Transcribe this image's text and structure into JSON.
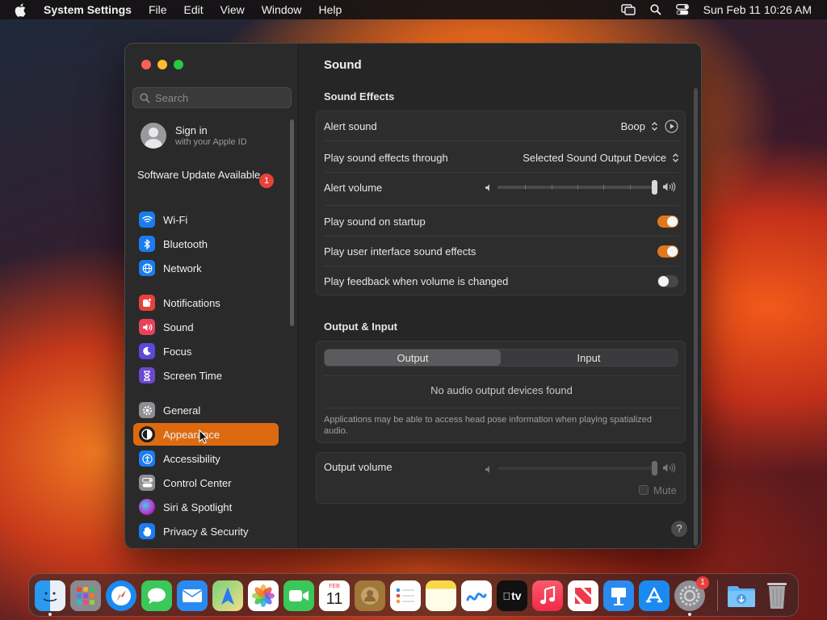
{
  "menubar": {
    "app_name": "System Settings",
    "menus": [
      "File",
      "Edit",
      "View",
      "Window",
      "Help"
    ],
    "datetime": "Sun Feb 11  10:26 AM"
  },
  "sidebar": {
    "search_placeholder": "Search",
    "apple_id": {
      "title": "Sign in",
      "subtitle": "with your Apple ID"
    },
    "software_update": {
      "label": "Software Update Available",
      "badge": "1"
    },
    "items": [
      {
        "label": "Wi-Fi",
        "icon": "wifi-icon",
        "color": "#1a7cf0"
      },
      {
        "label": "Bluetooth",
        "icon": "bluetooth-icon",
        "color": "#1a7cf0"
      },
      {
        "label": "Network",
        "icon": "globe-icon",
        "color": "#1a7cf0"
      },
      {
        "label": "Notifications",
        "icon": "bell-icon",
        "color": "#e8413a"
      },
      {
        "label": "Sound",
        "icon": "speaker-icon",
        "color": "#e8415a"
      },
      {
        "label": "Focus",
        "icon": "moon-icon",
        "color": "#5a4ad8"
      },
      {
        "label": "Screen Time",
        "icon": "hourglass-icon",
        "color": "#6a4ad0"
      },
      {
        "label": "General",
        "icon": "gear-icon",
        "color": "#8e8e93"
      },
      {
        "label": "Appearance",
        "icon": "appearance-icon",
        "color": "#1c1c1e"
      },
      {
        "label": "Accessibility",
        "icon": "accessibility-icon",
        "color": "#1a7cf0"
      },
      {
        "label": "Control Center",
        "icon": "control-center-icon",
        "color": "#8e8e93"
      },
      {
        "label": "Siri & Spotlight",
        "icon": "siri-icon",
        "color": "#c03ad0"
      },
      {
        "label": "Privacy & Security",
        "icon": "hand-icon",
        "color": "#1a7cf0"
      }
    ],
    "selected": "Appearance",
    "accent_color": "#de6a10"
  },
  "content": {
    "title": "Sound",
    "sound_effects": {
      "heading": "Sound Effects",
      "alert_sound_label": "Alert sound",
      "alert_sound_value": "Boop",
      "output_through_label": "Play sound effects through",
      "output_through_value": "Selected Sound Output Device",
      "alert_volume_label": "Alert volume",
      "alert_volume_level": 1.0,
      "startup_label": "Play sound on startup",
      "startup_on": true,
      "ui_effects_label": "Play user interface sound effects",
      "ui_effects_on": true,
      "feedback_label": "Play feedback when volume is changed",
      "feedback_on": false
    },
    "output_input": {
      "heading": "Output & Input",
      "tabs": [
        "Output",
        "Input"
      ],
      "active_tab": "Output",
      "empty_message": "No audio output devices found",
      "note": "Applications may be able to access head pose information when playing spatialized audio."
    },
    "output_volume": {
      "label": "Output volume",
      "level": 1.0,
      "mute_label": "Mute",
      "muted": false
    },
    "help": "?"
  },
  "dock": {
    "apps": [
      "Finder",
      "Launchpad",
      "Safari",
      "Messages",
      "Mail",
      "Maps",
      "Photos",
      "FaceTime",
      "Calendar",
      "Contacts",
      "Reminders",
      "Notes",
      "Freeform",
      "TV",
      "Music",
      "News",
      "Keynote",
      "App Store",
      "System Settings",
      "Downloads",
      "Trash"
    ],
    "calendar_month": "FEB",
    "calendar_day": "11",
    "tv_label": "tv",
    "settings_badge": "1"
  }
}
